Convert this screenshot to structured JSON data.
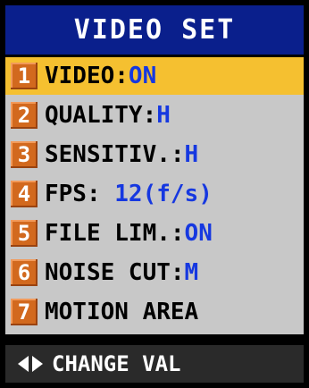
{
  "title": "VIDEO SET",
  "items": [
    {
      "num": "1",
      "label": "VIDEO:",
      "value": "ON",
      "selected": true
    },
    {
      "num": "2",
      "label": "QUALITY:",
      "value": "H",
      "selected": false
    },
    {
      "num": "3",
      "label": "SENSITIV.:",
      "value": "H",
      "selected": false
    },
    {
      "num": "4",
      "label": "FPS:",
      "value": " 12(f/s)",
      "selected": false
    },
    {
      "num": "5",
      "label": "FILE LIM.:",
      "value": "ON",
      "selected": false
    },
    {
      "num": "6",
      "label": "NOISE CUT:",
      "value": "M",
      "selected": false
    },
    {
      "num": "7",
      "label": "MOTION AREA",
      "value": "",
      "selected": false
    }
  ],
  "footer": {
    "text": "CHANGE VAL",
    "icons": [
      "left-arrow-icon",
      "right-arrow-icon"
    ]
  },
  "colors": {
    "title_bg": "#0a1f8c",
    "menu_bg": "#c8c8c8",
    "selected_bg": "#f5c030",
    "value": "#1638e0",
    "num_bg": "#d2691e"
  }
}
